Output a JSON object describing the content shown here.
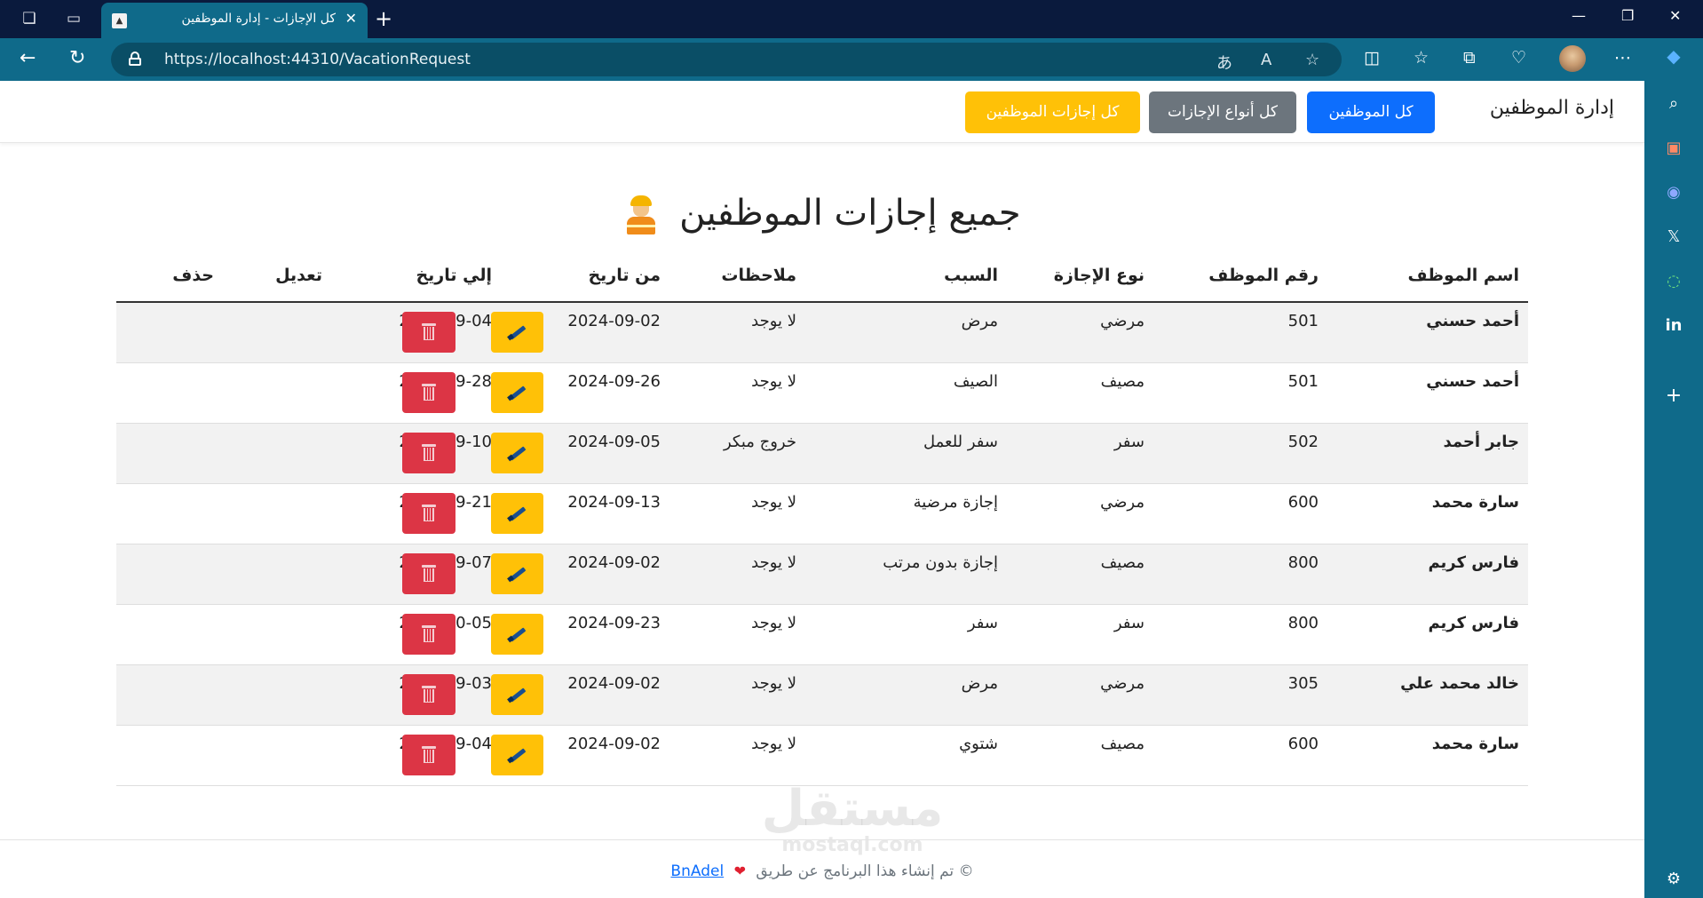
{
  "browser": {
    "tab_title": "كل الإجازات - إدارة الموظفين",
    "favicon": "app-icon",
    "url": "https://localhost:44310/VacationRequest"
  },
  "navbar": {
    "brand": "إدارة الموظفين",
    "buttons": [
      {
        "label": "كل الموظفين",
        "color": "#0d6efd"
      },
      {
        "label": "كل أنواع الإجازات",
        "color": "#6c757d"
      },
      {
        "label": "كل إجازات الموظفين",
        "color": "#ffc107"
      }
    ]
  },
  "heading": "جميع إجازات الموظفين",
  "table": {
    "headers": {
      "name": "اسم الموظف",
      "emp_no": "رقم الموظف",
      "type": "نوع الإجازة",
      "reason": "السبب",
      "notes": "ملاحظات",
      "from": "من تاريخ",
      "to": "إلي تاريخ",
      "edit": "تعديل",
      "delete": "حذف"
    },
    "rows": [
      {
        "name": "أحمد حسني",
        "emp_no": "501",
        "type": "مرضي",
        "reason": "مرض",
        "notes": "لا يوجد",
        "from": "2024-09-02",
        "to": "2024-09-04"
      },
      {
        "name": "أحمد حسني",
        "emp_no": "501",
        "type": "مصيف",
        "reason": "الصيف",
        "notes": "لا يوجد",
        "from": "2024-09-26",
        "to": "2024-09-28"
      },
      {
        "name": "جابر أحمد",
        "emp_no": "502",
        "type": "سفر",
        "reason": "سفر للعمل",
        "notes": "خروج مبكر",
        "from": "2024-09-05",
        "to": "2024-09-10"
      },
      {
        "name": "سارة محمد",
        "emp_no": "600",
        "type": "مرضي",
        "reason": "إجازة مرضية",
        "notes": "لا يوجد",
        "from": "2024-09-13",
        "to": "2024-09-21"
      },
      {
        "name": "فارس كريم",
        "emp_no": "800",
        "type": "مصيف",
        "reason": "إجازة بدون مرتب",
        "notes": "لا يوجد",
        "from": "2024-09-02",
        "to": "2024-09-07"
      },
      {
        "name": "فارس كريم",
        "emp_no": "800",
        "type": "سفر",
        "reason": "سفر",
        "notes": "لا يوجد",
        "from": "2024-09-23",
        "to": "2024-10-05"
      },
      {
        "name": "خالد محمد علي",
        "emp_no": "305",
        "type": "مرضي",
        "reason": "مرض",
        "notes": "لا يوجد",
        "from": "2024-09-02",
        "to": "2024-09-03"
      },
      {
        "name": "سارة محمد",
        "emp_no": "600",
        "type": "مصيف",
        "reason": "شتوي",
        "notes": "لا يوجد",
        "from": "2024-09-02",
        "to": "2024-09-04"
      }
    ]
  },
  "footer": {
    "text": "© تم إنشاء هذا البرنامج عن طريق",
    "author": "BnAdel"
  },
  "watermark": {
    "line1": "مستقل",
    "line2": "mostaql.com"
  }
}
